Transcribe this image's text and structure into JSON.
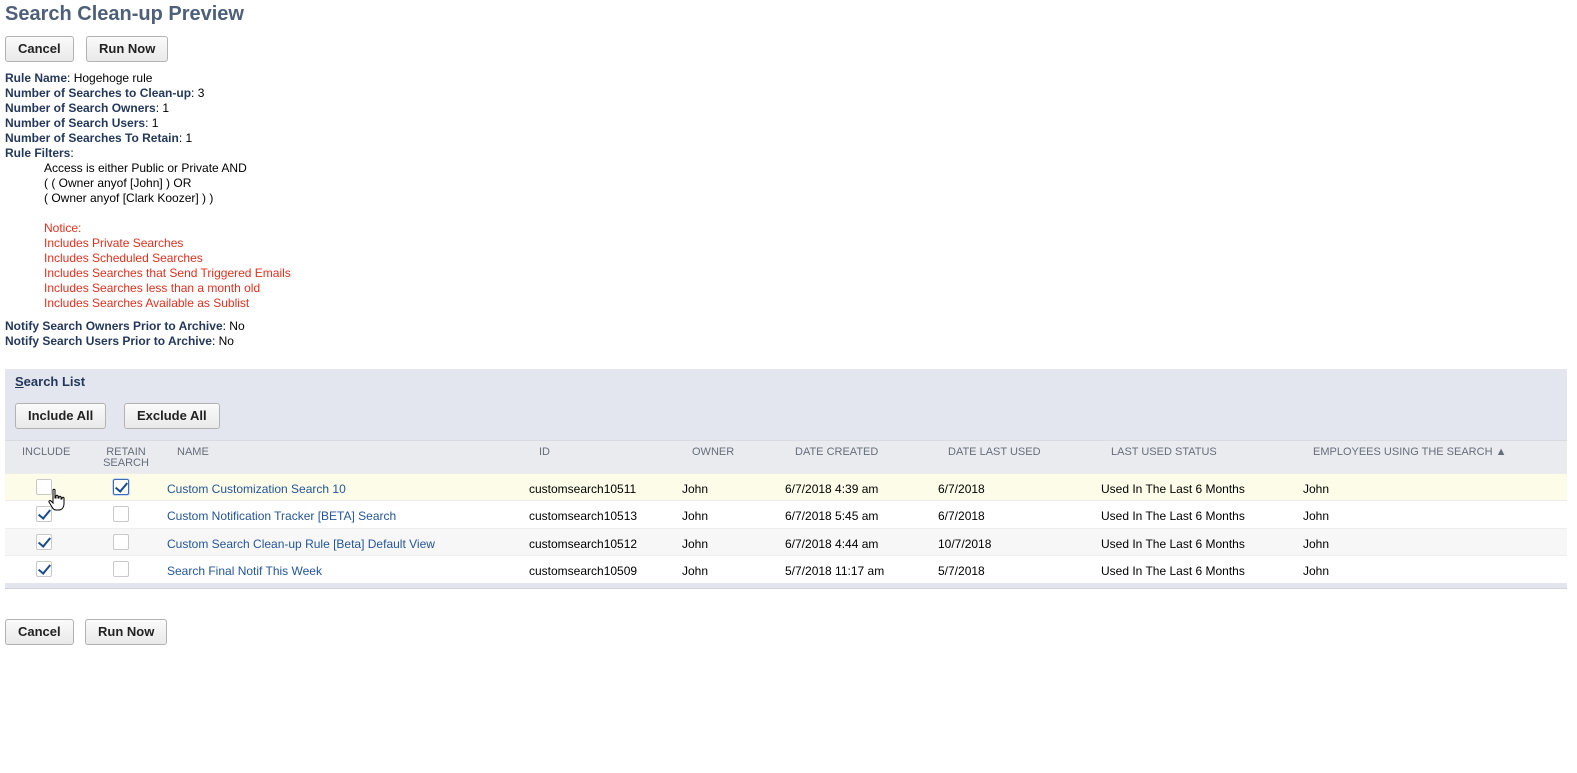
{
  "page": {
    "title": "Search Clean-up Preview"
  },
  "buttons": {
    "cancel": "Cancel",
    "run_now": "Run Now",
    "include_all": "Include All",
    "exclude_all": "Exclude All"
  },
  "rule": {
    "name_label": "Rule Name",
    "name": "Hogehoge rule",
    "searches_label": "Number of Searches to Clean-up",
    "searches": "3",
    "owners_label": "Number of Search Owners",
    "owners": "1",
    "users_label": "Number of Search Users",
    "users": "1",
    "retain_label": "Number of Searches To Retain",
    "retain": "1",
    "filters_label": "Rule Filters",
    "filters": [
      "Access is either Public or Private AND",
      "( ( Owner anyof [John] ) OR",
      "( Owner anyof [Clark Koozer] ) )"
    ],
    "notices": [
      "Notice:",
      "Includes Private Searches",
      "Includes Scheduled Searches",
      "Includes Searches that Send Triggered Emails",
      "Includes Searches less than a month old",
      "Includes Searches Available as Sublist"
    ]
  },
  "notify": {
    "owners_label": "Notify Search Owners Prior to Archive",
    "owners": "No",
    "users_label": "Notify Search Users Prior to Archive",
    "users": "No"
  },
  "search_list": {
    "title_first": "S",
    "title_rest": "earch List",
    "columns": [
      "INCLUDE",
      "RETAIN SEARCH",
      "NAME",
      "ID",
      "OWNER",
      "DATE CREATED",
      "DATE LAST USED",
      "LAST USED STATUS",
      "EMPLOYEES USING THE SEARCH ▲"
    ],
    "rows": [
      {
        "include": false,
        "retain": true,
        "name": "Custom Customization Search 10",
        "id": "customsearch10511",
        "owner": "John",
        "created": "6/7/2018 4:39 am",
        "last_used": "6/7/2018",
        "status": "Used In The Last 6 Months",
        "employees": "John"
      },
      {
        "include": true,
        "retain": false,
        "name": "Custom Notification Tracker [BETA] Search",
        "id": "customsearch10513",
        "owner": "John",
        "created": "6/7/2018 5:45 am",
        "last_used": "6/7/2018",
        "status": "Used In The Last 6 Months",
        "employees": "John"
      },
      {
        "include": true,
        "retain": false,
        "name": "Custom Search Clean-up Rule [Beta] Default View",
        "id": "customsearch10512",
        "owner": "John",
        "created": "6/7/2018 4:44 am",
        "last_used": "10/7/2018",
        "status": "Used In The Last 6 Months",
        "employees": "John"
      },
      {
        "include": true,
        "retain": false,
        "name": "Search Final Notif This Week",
        "id": "customsearch10509",
        "owner": "John",
        "created": "5/7/2018 11:17 am",
        "last_used": "5/7/2018",
        "status": "Used In The Last 6 Months",
        "employees": "John"
      }
    ]
  },
  "colors": {
    "title": "#4d5f79",
    "label": "#24385b",
    "notice": "#e0301e",
    "link": "#255599",
    "panel": "#e3e6ee"
  }
}
